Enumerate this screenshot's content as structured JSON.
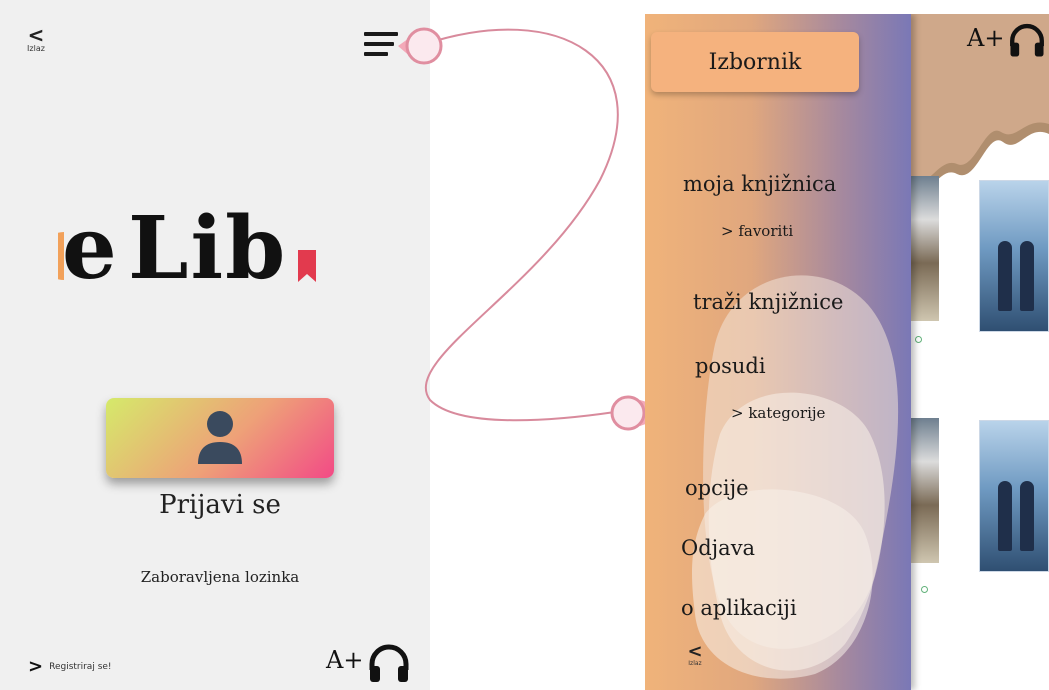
{
  "login": {
    "back_chevron": "<",
    "back_label": "Izlaz",
    "logo": {
      "prefix": "e",
      "letters": "Lib"
    },
    "login_label": "Prijavi se",
    "forgot_password": "Zaboravljena lozinka",
    "register_chevron": ">",
    "register_label": "Registriraj se!",
    "font_size_button": "A+",
    "audio_icon": "headphones-icon"
  },
  "menu": {
    "title": "Izbornik",
    "items": [
      {
        "label": "moja knjižnica"
      },
      {
        "label": "> favoriti"
      },
      {
        "label": "traži knjižnice"
      },
      {
        "label": "posudi"
      },
      {
        "label": "> kategorije"
      },
      {
        "label": "opcije"
      },
      {
        "label": "Odjava"
      },
      {
        "label": "o aplikaciji"
      }
    ],
    "back_chevron": "<",
    "back_label": "Izlaz",
    "font_size_button": "A+",
    "audio_icon": "headphones-icon"
  },
  "colors": {
    "login_bg": "#f0f0f0",
    "login_button_gradient": [
      "#d5ea6a",
      "#eea078",
      "#f24a86"
    ],
    "menu_gradient": [
      "#f0b37a",
      "#7a78b6"
    ],
    "menu_title_bg": "#f5b27e",
    "connector": "#d88a9c",
    "connector_bubble": "#f3a9b8"
  }
}
